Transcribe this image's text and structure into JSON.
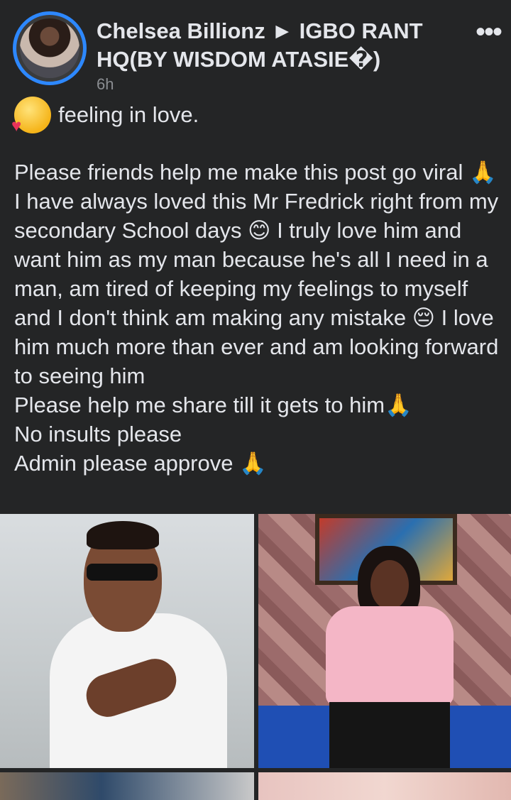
{
  "post": {
    "author": "Chelsea Billionz ► IGBO RANT HQ(BY WISDOM ATASIE�)",
    "time": "6h",
    "more_icon": "more-horizontal-icon",
    "feeling": "feeling in love.",
    "paragraphs": [
      "Please friends help me make this post go viral 🙏 I have always loved this Mr Fredrick right from my secondary School days 😊 I truly love him and want him as my man because he's all I need in a man, am tired of keeping my feelings to myself and I don't think am making any mistake 😔 I love him much more than ever and am looking forward to seeing him",
      "Please help me share till it gets to him🙏",
      "No insults please",
      "Admin please approve 🙏"
    ]
  },
  "colors": {
    "background": "#242526",
    "text": "#e4e6eb",
    "muted": "#8a8d91",
    "story_ring": "#2d88ff"
  }
}
